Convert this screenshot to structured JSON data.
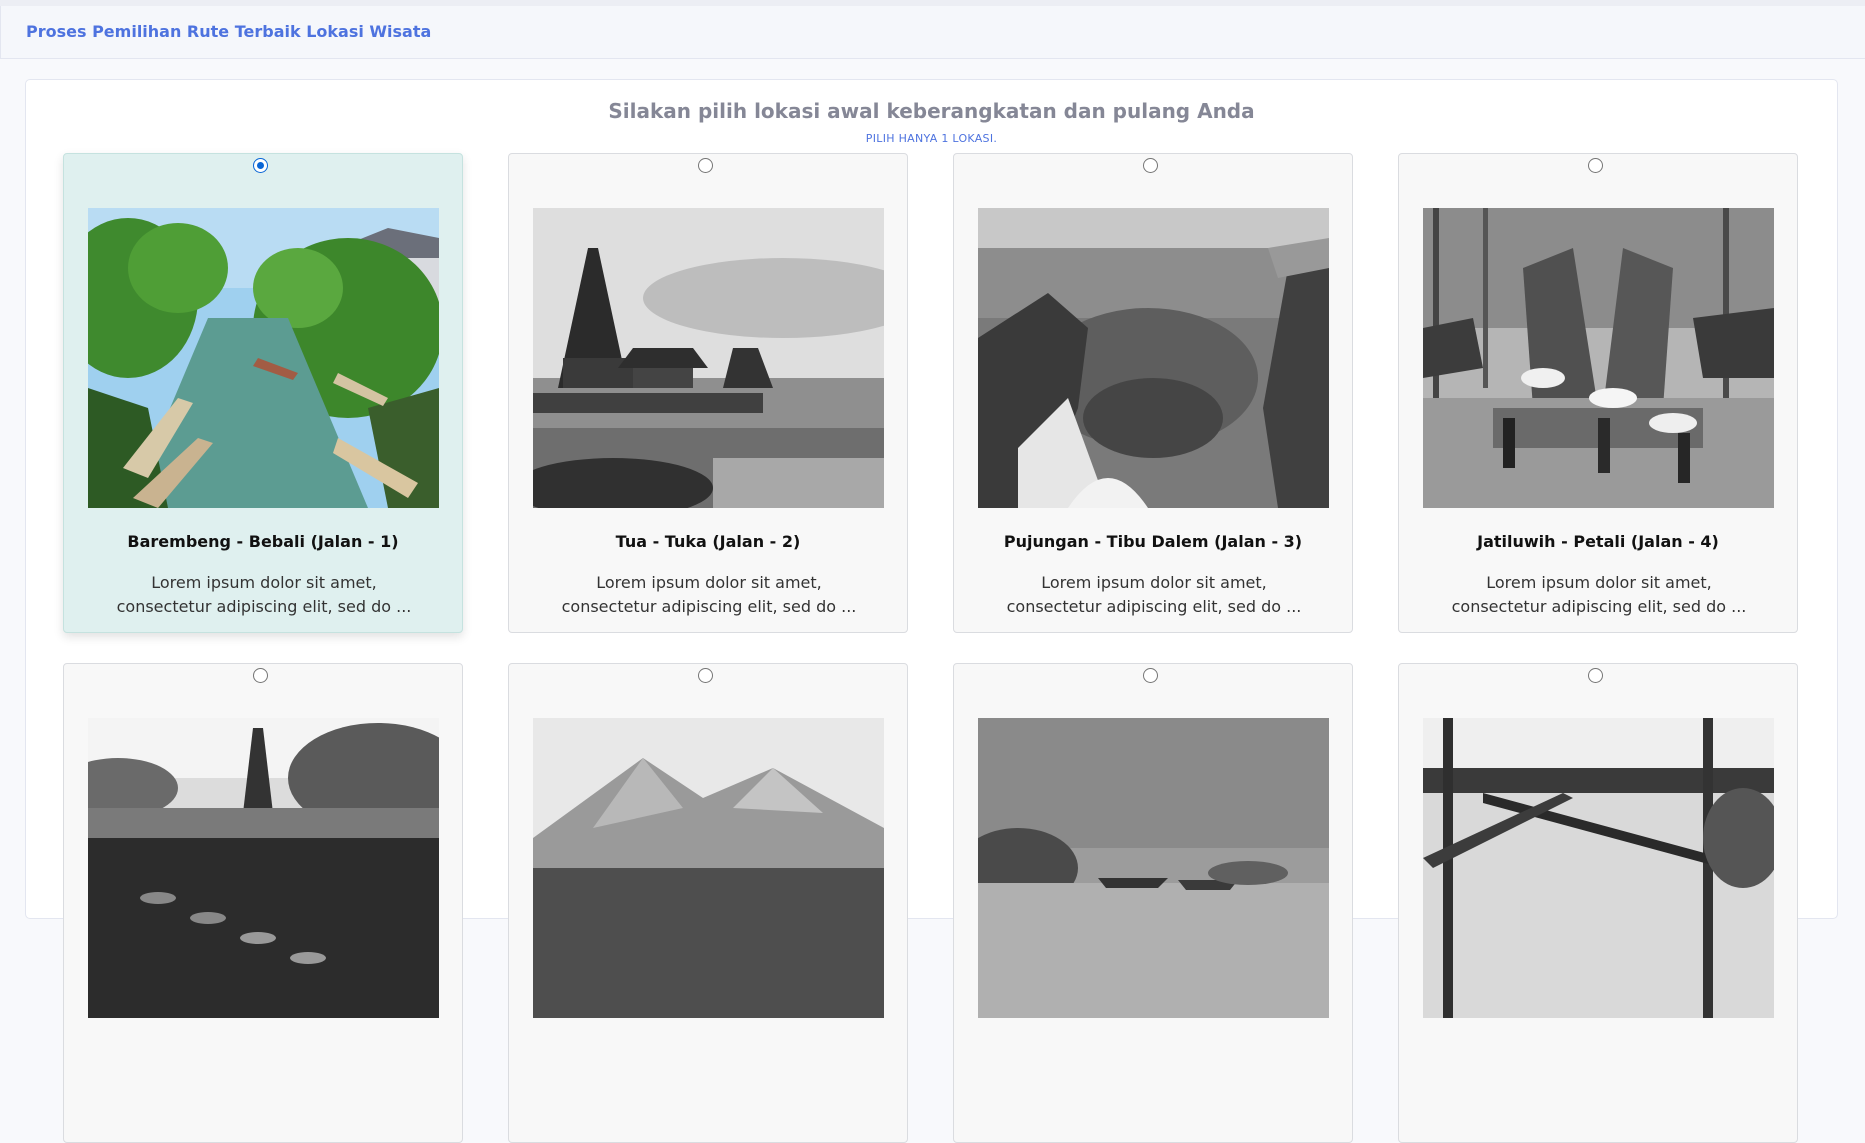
{
  "header": {
    "title": "Proses Pemilihan Rute Terbaik Lokasi Wisata"
  },
  "panel": {
    "heading": "Silakan pilih lokasi awal keberangkatan dan pulang Anda",
    "subheading": "PILIH HANYA 1 LOKASI."
  },
  "colors": {
    "accent": "#4e73df",
    "selected_card": "#dff0ef"
  },
  "cards": [
    {
      "title": "Barembeng - Bebali (Jalan - 1)",
      "text": "Lorem ipsum dolor sit amet, consectetur adipiscing elit, sed do ...",
      "selected": true,
      "photo": "canal-boats-image"
    },
    {
      "title": "Tua - Tuka (Jalan - 2)",
      "text": "Lorem ipsum dolor sit amet, consectetur adipiscing elit, sed do ...",
      "selected": false,
      "photo": "lake-temple-image"
    },
    {
      "title": "Pujungan - Tibu Dalem (Jalan - 3)",
      "text": "Lorem ipsum dolor sit amet, consectetur adipiscing elit, sed do ...",
      "selected": false,
      "photo": "cliff-beach-image"
    },
    {
      "title": "Jatiluwih - Petali (Jalan - 4)",
      "text": "Lorem ipsum dolor sit amet, consectetur adipiscing elit, sed do ...",
      "selected": false,
      "photo": "temple-gate-image"
    },
    {
      "title": "",
      "text": "",
      "selected": false,
      "photo": "water-palace-image"
    },
    {
      "title": "",
      "text": "",
      "selected": false,
      "photo": "mountain-image"
    },
    {
      "title": "",
      "text": "",
      "selected": false,
      "photo": "harbor-boats-image"
    },
    {
      "title": "",
      "text": "",
      "selected": false,
      "photo": "bamboo-structure-image"
    }
  ]
}
